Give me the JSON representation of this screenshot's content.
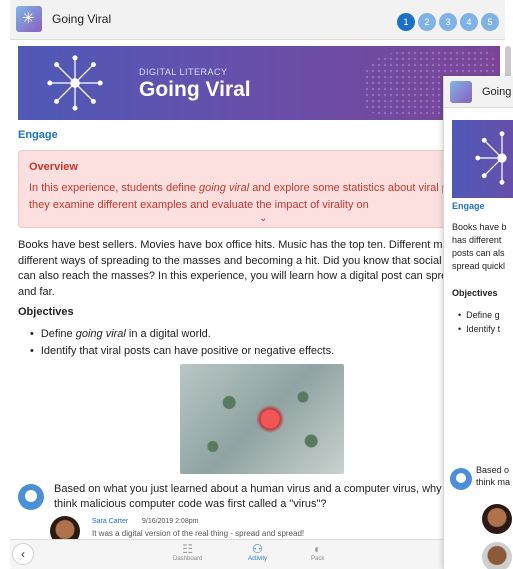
{
  "main": {
    "header": {
      "title": "Going Viral",
      "steps": [
        "1",
        "2",
        "3",
        "4",
        "5"
      ],
      "active_step": "1"
    },
    "banner": {
      "eyebrow": "DIGITAL LITERACY",
      "title": "Going Viral"
    },
    "section_label": "Engage",
    "overview": {
      "heading": "Overview",
      "text_before": "In this experience, students define ",
      "text_em": "going viral",
      "text_after": " and explore some statistics about viral posts. Then they examine different examples and evaluate the impact of virality on"
    },
    "paragraph": "Books have best sellers. Movies have box office hits. Music has the top ten. Different media has different ways of spreading to the masses and becoming a hit. Did you know that social media posts can also reach the masses? In this experience, you will learn how a digital post can spread quickly and far.",
    "objectives": {
      "heading": "Objectives",
      "item1_before": "Define ",
      "item1_em": "going viral",
      "item1_after": " in a digital world.",
      "item2": "Identify that viral posts can have positive or negative effects."
    },
    "question": "Based on what you just learned about a human virus and a computer virus, why do you think malicious computer code was first called a \"virus\"?",
    "comment": {
      "author": "Sara Carter",
      "date": "9/16/2019 2:08pm",
      "text": "It was a digital version of the real thing - spread and spread!"
    },
    "bottom_nav": {
      "back_icon": "chevron-left-icon",
      "items": [
        {
          "label": "Dashboard",
          "icon": "dashboard-icon"
        },
        {
          "label": "Activity",
          "icon": "activity-icon"
        },
        {
          "label": "Pack",
          "icon": "pack-icon"
        }
      ],
      "active": "Activity"
    }
  },
  "side_panel": {
    "title": "Going",
    "section_label": "Engage",
    "paragraph_lines": [
      "Books have b",
      "has different",
      "posts can als",
      "spread quickl"
    ],
    "objectives_heading": "Objectives",
    "objectives": [
      "Define g",
      "Identify t"
    ],
    "question_lines": [
      "Based o",
      "think ma"
    ]
  },
  "colors": {
    "accent": "#1d72c9",
    "overview_bg": "#fbe0df",
    "overview_text": "#c7372f",
    "banner_start": "#4f59b7",
    "banner_end": "#7a4596"
  }
}
